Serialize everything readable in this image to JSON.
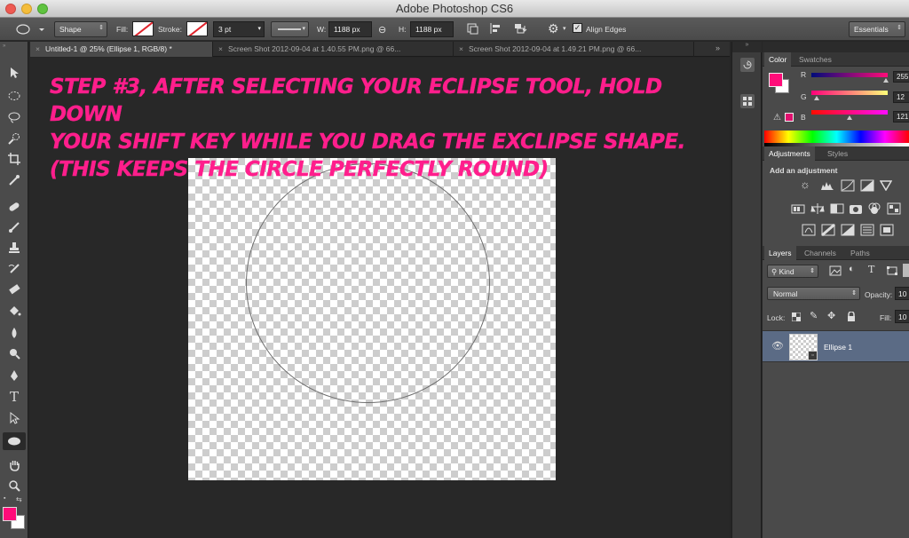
{
  "app": {
    "title": "Adobe Photoshop CS6"
  },
  "options": {
    "tool_mode": "Shape",
    "fill_label": "Fill:",
    "stroke_label": "Stroke:",
    "stroke_width": "3 pt",
    "w_label": "W:",
    "w_value": "1188 px",
    "h_label": "H:",
    "h_value": "1188 px",
    "align_edges": "Align Edges",
    "workspace": "Essentials"
  },
  "tabs": [
    {
      "label": "Untitled-1 @ 25% (Ellipse 1, RGB/8) *"
    },
    {
      "label": "Screen Shot 2012-09-04 at 1.40.55 PM.png @ 66..."
    },
    {
      "label": "Screen Shot 2012-09-04 at 1.49.21 PM.png @ 66..."
    }
  ],
  "annotation": {
    "text": "Step #3, after selecting your eclipse tool, Hold down\nyour shift key while you drag the exclipse shape.\n(this keeps the circle perfectly round)"
  },
  "color_panel": {
    "tabs": [
      "Color",
      "Swatches"
    ],
    "channels": [
      {
        "label": "R",
        "value": "255"
      },
      {
        "label": "G",
        "value": "12"
      },
      {
        "label": "B",
        "value": "121"
      }
    ],
    "foreground": "#ff0c79"
  },
  "adjustments_panel": {
    "tabs": [
      "Adjustments",
      "Styles"
    ],
    "heading": "Add an adjustment"
  },
  "layers_panel": {
    "tabs": [
      "Layers",
      "Channels",
      "Paths"
    ],
    "filter": "Kind",
    "blend_mode": "Normal",
    "opacity_label": "Opacity:",
    "opacity_value": "10",
    "lock_label": "Lock:",
    "fill_label": "Fill:",
    "fill_value": "10",
    "layers": [
      {
        "name": "Ellipse 1"
      }
    ]
  },
  "colors": {
    "accent": "#ff1e8c",
    "selected_layer": "#5b6b85"
  }
}
